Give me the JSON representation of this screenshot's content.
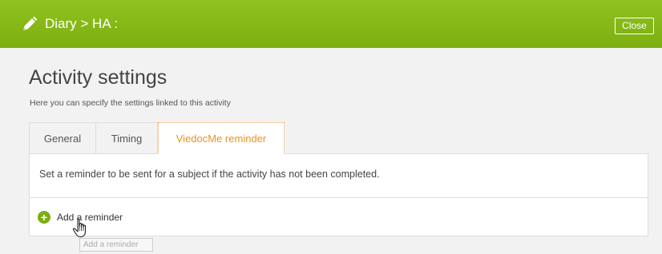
{
  "header": {
    "breadcrumb": "Diary > HA :",
    "close_label": "Close"
  },
  "main": {
    "title": "Activity settings",
    "subtitle": "Here you can specify the settings linked to this activity"
  },
  "tabs": [
    {
      "label": "General",
      "active": false
    },
    {
      "label": "Timing",
      "active": false
    },
    {
      "label": "ViedocMe reminder",
      "active": true
    }
  ],
  "panel": {
    "description": "Set a reminder to be sent for a subject if the activity has not been completed.",
    "add_reminder_label": "Add a reminder"
  },
  "tooltip": {
    "text": "Add a reminder"
  },
  "colors": {
    "header_green": "#7cae10",
    "active_tab": "#e8931e",
    "plus_icon": "#7cae10"
  },
  "icons": {
    "header": "pencil-icon",
    "add": "plus-circle-icon",
    "cursor": "hand-pointer-icon"
  }
}
